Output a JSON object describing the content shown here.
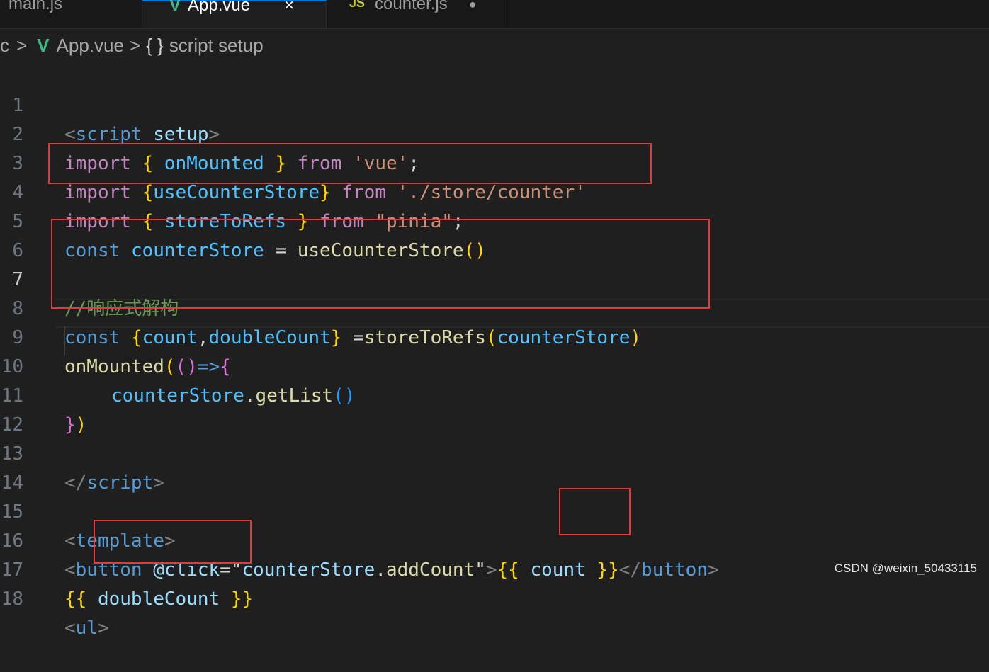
{
  "tabs": [
    {
      "label": "main.js",
      "icon": ""
    },
    {
      "label": "App.vue",
      "icon": "vue-icon",
      "close": "×"
    },
    {
      "label": "counter.js",
      "icon": "JS",
      "dot": "●"
    }
  ],
  "breadcrumb": {
    "root": "c",
    "sep": ">",
    "file": "App.vue",
    "symbol_icon": "{ }",
    "symbol": "script setup"
  },
  "code": {
    "line_numbers": [
      "1",
      "2",
      "3",
      "4",
      "5",
      "6",
      "7",
      "8",
      "9",
      "10",
      "11",
      "12",
      "13",
      "14",
      "15",
      "16",
      "17",
      "18"
    ],
    "script_open": "script",
    "setup_attr": "setup",
    "import_kw": "import",
    "from_kw": "from",
    "const_kw": "const",
    "onMounted": "onMounted",
    "vue_str": "'vue'",
    "useCounterStore": "useCounterStore",
    "store_path_str": "'./store/counter'",
    "storeToRefs": "storeToRefs",
    "pinia_str": "\"pinia\"",
    "counterStore": "counterStore",
    "comment": "//响应式解构",
    "count": "count",
    "doubleCount": "doubleCount",
    "getList": "getList",
    "template_tag": "template",
    "button_tag": "button",
    "click_attr": "@click",
    "click_value": "\"counterStore.addCount\"",
    "ul_tag": "ul"
  },
  "watermark": "CSDN @weixin_50433115",
  "colors": {
    "highlight_box": "#e03a3a",
    "background": "#1f1f1f"
  }
}
